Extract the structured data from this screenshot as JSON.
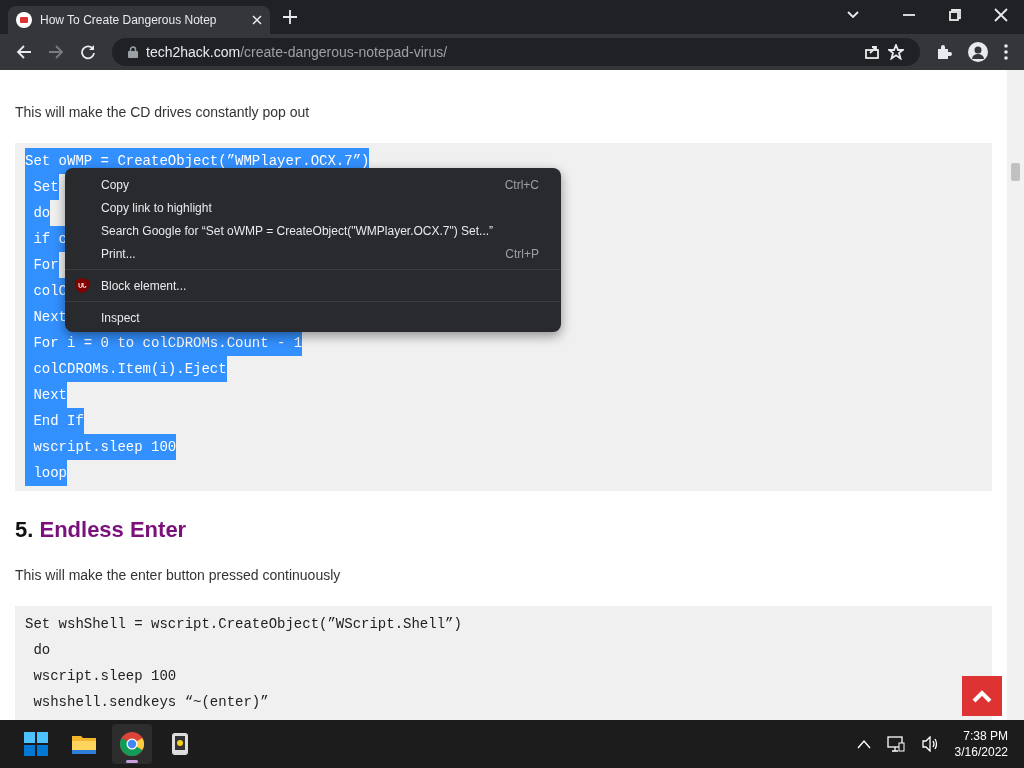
{
  "browser": {
    "tab": {
      "title": "How To Create Dangerous Notep",
      "selected": true
    },
    "url": {
      "domain": "tech2hack.com",
      "path": "/create-dangerous-notepad-virus/"
    }
  },
  "article": [
    {
      "kind": "paragraph",
      "text": "This will make the CD drives constantly pop out"
    },
    {
      "kind": "code",
      "lines": [
        {
          "text": "Set oWMP = CreateObject(”WMPlayer.OCX.7”)",
          "selected": true
        },
        {
          "text": " Set",
          "selected": true
        },
        {
          "text": " do",
          "selected": true
        },
        {
          "text": " if c",
          "selected": true
        },
        {
          "text": " For",
          "selected": true
        },
        {
          "text": " colC",
          "selected": true
        },
        {
          "text": " Next",
          "selected": true
        },
        {
          "text": " For i = 0 to colCDROMs.Count - 1",
          "selected": true
        },
        {
          "text": " colCDROMs.Item(i).Eject",
          "selected": true
        },
        {
          "text": " Next",
          "selected": true
        },
        {
          "text": " End If",
          "selected": true
        },
        {
          "text": " wscript.sleep 100",
          "selected": true
        },
        {
          "text": " loop",
          "selected": true
        }
      ]
    },
    {
      "kind": "heading",
      "number": "5.",
      "title": "Endless Enter"
    },
    {
      "kind": "paragraph",
      "text": "This will make the enter button pressed continuously"
    },
    {
      "kind": "code",
      "lines": [
        {
          "text": "Set wshShell = wscript.CreateObject(”WScript.Shell”)",
          "selected": false
        },
        {
          "text": " do",
          "selected": false
        },
        {
          "text": " wscript.sleep 100",
          "selected": false
        },
        {
          "text": " wshshell.sendkeys “~(enter)”",
          "selected": false
        }
      ]
    }
  ],
  "context_menu": [
    {
      "kind": "item",
      "label": "Copy",
      "shortcut": "Ctrl+C"
    },
    {
      "kind": "item",
      "label": "Copy link to highlight"
    },
    {
      "kind": "item",
      "label": "Search Google for “Set oWMP = CreateObject(\"WMPlayer.OCX.7\")  Set...”"
    },
    {
      "kind": "item",
      "label": "Print...",
      "shortcut": "Ctrl+P"
    },
    {
      "kind": "divider"
    },
    {
      "kind": "extension",
      "label": "Block element..."
    },
    {
      "kind": "divider"
    },
    {
      "kind": "item",
      "label": "Inspect"
    }
  ],
  "taskbar": {
    "apps": [
      {
        "kind": "start",
        "active": false
      },
      {
        "kind": "folder",
        "active": false
      },
      {
        "kind": "browser",
        "active": true
      },
      {
        "kind": "app",
        "active": false
      }
    ],
    "time": "7:38 PM",
    "date": "3/16/2022"
  }
}
